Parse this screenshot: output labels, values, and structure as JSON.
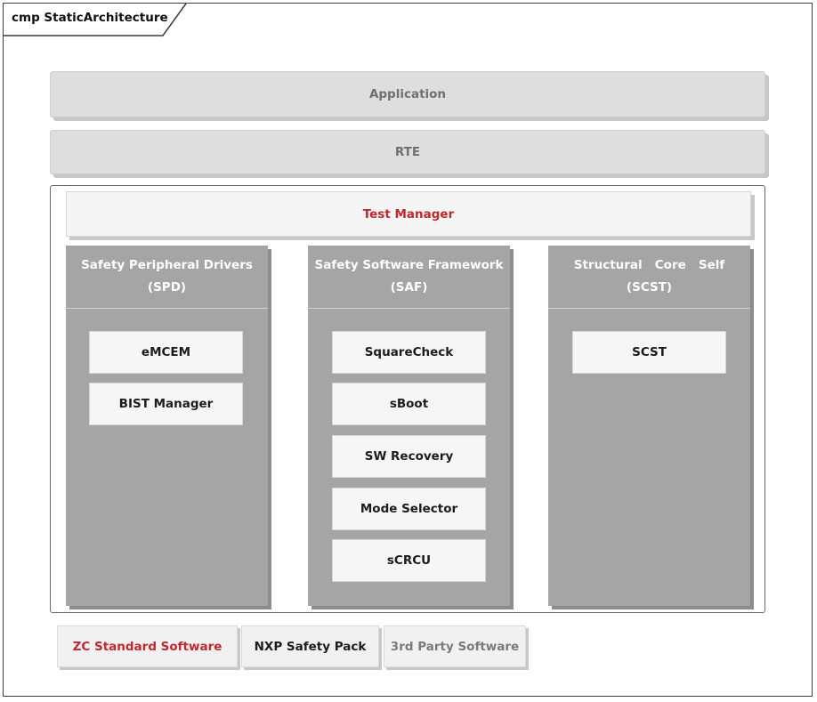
{
  "diagram": {
    "frame_label": "cmp StaticArchitecture",
    "layers": {
      "application": "Application",
      "rte": "RTE"
    },
    "test_manager": "Test Manager",
    "columns": [
      {
        "title_line1": "Safety Peripheral Drivers",
        "title_line2": "(SPD)",
        "modules": [
          "eMCEM",
          "BIST Manager"
        ]
      },
      {
        "title_line1": "Safety Software Framework",
        "title_line2": "(SAF)",
        "modules": [
          "SquareCheck",
          "sBoot",
          "SW Recovery",
          "Mode Selector",
          "sCRCU"
        ]
      },
      {
        "title_line1": "Structural   Core   Self",
        "title_line2": "(SCST)",
        "modules": [
          "SCST"
        ]
      }
    ],
    "legend": [
      {
        "label": "ZC Standard Software",
        "color": "#c0282d"
      },
      {
        "label": "NXP Safety Pack",
        "color": "#1c1c1c"
      },
      {
        "label": "3rd Party Software",
        "color": "#7a7a7a"
      }
    ]
  }
}
